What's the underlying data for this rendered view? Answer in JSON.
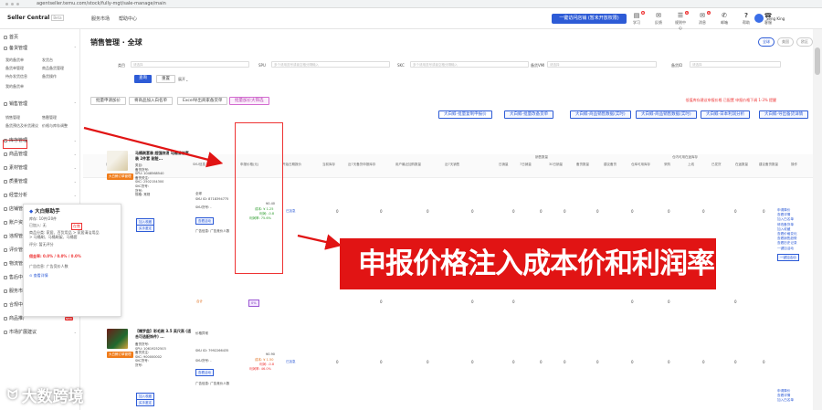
{
  "browser": {
    "url": "agentseller.temu.com/stock/fully-mgt/sale-manage/main"
  },
  "topbar": {
    "brand": "Seller Central",
    "brand_tag": "Beta",
    "nav": [
      "服务市场",
      "帮助中心"
    ],
    "download_btn": "一键访问店铺 (暂未开放权限)",
    "icons": [
      {
        "label": "学习",
        "badge": "6"
      },
      {
        "label": "反馈"
      },
      {
        "label": "规则中心",
        "badge": "1"
      },
      {
        "label": "消息",
        "badge": "1"
      },
      {
        "label": "邮箱"
      },
      {
        "label": "帮助"
      },
      {
        "label": "客服"
      }
    ],
    "user": "Seng King"
  },
  "sidebar": {
    "items": [
      {
        "label": "首页"
      },
      {
        "label": "备货管理"
      },
      {
        "label": "销售管理"
      },
      {
        "label": "库存管理"
      },
      {
        "label": "商品管理"
      },
      {
        "label": "素材管理"
      },
      {
        "label": "质量管理"
      },
      {
        "label": "经营分析"
      },
      {
        "label": "店铺管理"
      },
      {
        "label": "账户资金"
      },
      {
        "label": "违规管理"
      },
      {
        "label": "评价管理"
      },
      {
        "label": "物流管理"
      },
      {
        "label": "售后中心"
      },
      {
        "label": "服务市场"
      },
      {
        "label": "合规中心"
      },
      {
        "label": "商品推广"
      },
      {
        "label": "市场扩展建议"
      }
    ],
    "subs": [
      "我的备货单",
      "发货台",
      "备货单管理",
      "商品备货管理",
      "待办发货信息",
      "备货操作"
    ],
    "sales_subs": [
      "销售管理",
      "售罄管理",
      "备货预估及补货建议",
      "价格与库存调整"
    ],
    "hot": "NEW"
  },
  "main": {
    "title": "销售管理 · 全球",
    "pills": [
      "全球",
      "美国",
      "欧区"
    ],
    "filters": {
      "labels": [
        "类目",
        "SPU",
        "SKC",
        "备货VMI",
        "备货ID"
      ],
      "placeholder": "请选择",
      "placeholder2": "多个请用逗号或者空格分隔输入"
    },
    "search_btn": "查询",
    "reset_btn": "重置",
    "expand": "展开",
    "action_btns": [
      "批量申请加价",
      "将商品加入白名单",
      "Excel导出商家备货单",
      "批量加价大筛选"
    ],
    "warning": "低值库存建议申报价格   已配置   申报价格下调 1-3%  提醒",
    "tool_btns": [
      "大白鲸-批量复制申报价",
      "大白鲸-批量改备货单",
      "大白鲸-商品销售数据(实时)",
      "大白鲸-商品销售数据(实时)",
      "大白鲸-日本利润分析",
      "大白鲸-导出备货详情"
    ],
    "headers": [
      "商品信息",
      "SKU信息",
      "申报价格(元)",
      "开始日期报价",
      "当前库存",
      "近7天备货申报库存",
      "用户最近加购数量",
      "近7天销售",
      "日销量",
      "7日销量",
      "30日销量",
      "销售数量",
      "备货数量",
      "建议备货",
      "仓库可用库存",
      "仓内可用在途库存",
      "采购",
      "上线",
      "已发货",
      "在途数量",
      "库存状态",
      "建议备货数量",
      "操作"
    ],
    "overlay": "申报价格注入成本价和利润率等",
    "watermark": "大数跨境"
  },
  "product1": {
    "title": "马桶刷套装 超强除渍 马桶清洁套装 2件套 耐脏...",
    "tag": "大白鲸订单管理",
    "meta": [
      "类目:",
      "备货货号:",
      "SPU: 1048568540",
      "备货关注:",
      "SKC: 2502154300",
      "SKC货号:",
      "货号:",
      "规格: 常规"
    ],
    "buttons": [
      "加入收藏",
      "买手鉴定",
      "修改备货单",
      "暂无"
    ],
    "sku": "SKU ID: 8718394775",
    "sku_label": "SKU货号: -",
    "apply_btn": "查看活动",
    "price": "¥0.40",
    "cost": "成本: ¥ 1.25",
    "profit": "利润: -0.8",
    "rate": "利润率: 75.6%",
    "status": "已加急",
    "panel_title": "大白鲸助手",
    "panel_rows": [
      "库存: 10件/20件",
      "已加入: 无",
      "在售",
      "",
      "商品分类: 家居、百货用品 > 家居清洁用品",
      "> 马桶刷、马桶刷架、马桶套",
      "评分: 暂无评分",
      "",
      "",
      "佣金率: 0.0% / 0.0% / 0.0%",
      "广告信息: 广告竞价人数",
      "",
      "查看详情"
    ],
    "panel_qty": "总量",
    "panel_price": "¥0.00"
  },
  "product2": {
    "title": "【赠罗盘】彩毛刷 3.5 英尺高 (适合可选配饰件) ...",
    "tag": "大白鲸订单管理",
    "meta": [
      "备货货号:",
      "SPU: 10619252503",
      "备货关注:",
      "SKC: 900000002",
      "SKC货号:",
      "货号:"
    ],
    "buttons": [
      "加入收藏",
      "买手鉴定",
      "修改备货单"
    ],
    "sku": "SKU ID: 7992266435",
    "sku_label": "SKU货号: -",
    "apply_btn": "查看活动",
    "price": "¥0.90",
    "cost": "成本: ¥ 1.50",
    "profit": "利润: -0.8",
    "rate": "利润率: 46.0%",
    "status": "已加急",
    "red_tag": "价格异常"
  },
  "actions1": [
    "申请降价",
    "查看详情",
    "加入白名单",
    "修改备货单",
    "加入收藏",
    "查看价格变化",
    "查看销售趋势",
    "查看历史记录",
    "一键加活动"
  ],
  "actions_single": "一键加活动",
  "actions2": [
    "申请降价",
    "查看详情",
    "加入白名单"
  ],
  "zero": "0",
  "totals": {
    "label": "合计",
    "v1": "0%"
  },
  "row_label": "普通"
}
